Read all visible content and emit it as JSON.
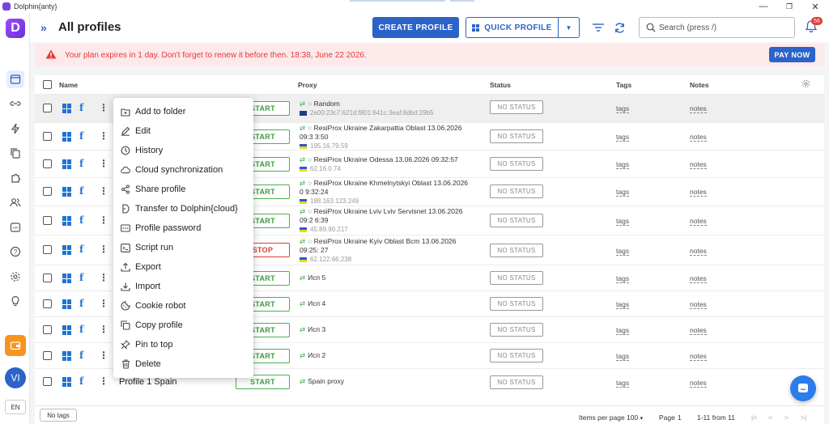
{
  "window": {
    "title": "Dolphin{anty}",
    "controls": [
      "—",
      "❐",
      "✕"
    ]
  },
  "header": {
    "title": "All profiles",
    "create_label": "CREATE PROFILE",
    "quick_label": "QUICK PROFILE",
    "search_placeholder": "Search (press /)",
    "notifications_count": "56"
  },
  "sidebar": {
    "lang": "EN",
    "avatar": "VI"
  },
  "banner": {
    "text": "Your plan expires in 1 day. Don't forget to renew it before then. 18:38, June 22 2026.",
    "pay_label": "PAY NOW"
  },
  "table": {
    "columns": {
      "name": "Name",
      "proxy": "Proxy",
      "status": "Status",
      "tags": "Tags",
      "notes": "Notes"
    },
    "rows": [
      {
        "action": "START",
        "proxy": "Random",
        "proxy_sub": "2a00:23c7:621d:f801:641c:3eaf:8dbd:29b5",
        "flag": "uk",
        "status": "NO STATUS",
        "tags": "tags",
        "notes": "notes"
      },
      {
        "action": "START",
        "proxy": "ResiProx Ukraine Zakarpattia Oblast 13.06.2026 09:3 3:50",
        "proxy_sub": "195.16.79.59",
        "flag": "ua",
        "status": "NO STATUS",
        "tags": "tags",
        "notes": "notes"
      },
      {
        "action": "START",
        "proxy": "ResiProx Ukraine Odessa 13.06.2026 09:32:57",
        "proxy_sub": "62.16.0.74",
        "flag": "ua",
        "status": "NO STATUS",
        "tags": "tags",
        "notes": "notes"
      },
      {
        "action": "START",
        "proxy": "ResiProx Ukraine Khmelnytskyi Oblast 13.06.2026 0 9:32:24",
        "proxy_sub": "188.163.123.249",
        "flag": "ua",
        "status": "NO STATUS",
        "tags": "tags",
        "notes": "notes"
      },
      {
        "action": "START",
        "proxy": "ResiProx Ukraine Lviv Lviv Servisnet 13.06.2026 09:2 6:39",
        "proxy_sub": "45.89.90.217",
        "flag": "ua",
        "status": "NO STATUS",
        "tags": "tags",
        "notes": "notes"
      },
      {
        "action": "STOP",
        "proxy": "ResiProx Ukraine Kyiv Oblast Bcm 13.06.2026 09:25: 27",
        "proxy_sub": "62.122.66.238",
        "flag": "ua",
        "status": "NO STATUS",
        "tags": "tags",
        "notes": "notes"
      },
      {
        "action": "START",
        "proxy": "Исп 5",
        "status": "NO STATUS",
        "tags": "tags",
        "notes": "notes"
      },
      {
        "action": "START",
        "proxy": "Исп 4",
        "status": "NO STATUS",
        "tags": "tags",
        "notes": "notes"
      },
      {
        "action": "START",
        "proxy": "Исп 3",
        "status": "NO STATUS",
        "tags": "tags",
        "notes": "notes"
      },
      {
        "action": "START",
        "proxy": "Исп 2",
        "status": "NO STATUS",
        "tags": "tags",
        "notes": "notes"
      },
      {
        "name": "Profile 1 Spain",
        "action": "START",
        "proxy": "Spain proxy",
        "status": "NO STATUS",
        "tags": "tags",
        "notes": "notes"
      }
    ]
  },
  "context_menu": [
    {
      "label": "Add to folder",
      "icon": "folder-plus-icon"
    },
    {
      "label": "Edit",
      "icon": "edit-icon"
    },
    {
      "label": "History",
      "icon": "history-icon"
    },
    {
      "label": "Cloud synchronization",
      "icon": "cloud-icon"
    },
    {
      "label": "Share profile",
      "icon": "share-icon"
    },
    {
      "label": "Transfer to Dolphin{cloud}",
      "icon": "dolphin-icon"
    },
    {
      "label": "Profile password",
      "icon": "password-icon"
    },
    {
      "label": "Script run",
      "icon": "script-icon"
    },
    {
      "label": "Export",
      "icon": "export-icon"
    },
    {
      "label": "Import",
      "icon": "import-icon"
    },
    {
      "label": "Cookie robot",
      "icon": "cookie-icon"
    },
    {
      "label": "Copy profile",
      "icon": "copy-icon"
    },
    {
      "label": "Pin to top",
      "icon": "pin-icon"
    },
    {
      "label": "Delete",
      "icon": "trash-icon"
    }
  ],
  "footer": {
    "no_tags": "No tags",
    "items_per_page_label": "Items per page",
    "items_per_page": "100",
    "page_label": "Page",
    "page": "1",
    "range": "1-11 from 11"
  },
  "colors": {
    "accent": "#2b63c8",
    "start": "#4caf50",
    "stop": "#e53935",
    "warning": "#e53935",
    "wallet": "#f7941d"
  }
}
